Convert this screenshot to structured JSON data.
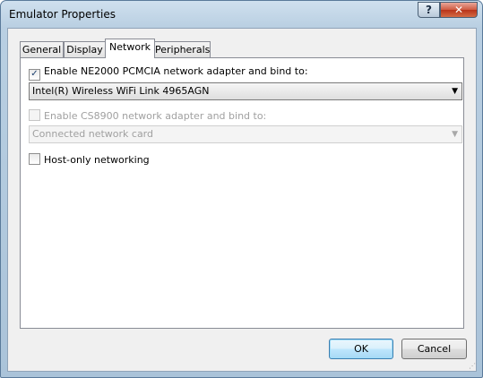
{
  "window": {
    "title": "Emulator Properties",
    "help_label": "?",
    "close_label": "✕"
  },
  "tabs": [
    {
      "label": "General",
      "active": false
    },
    {
      "label": "Display",
      "active": false
    },
    {
      "label": "Network",
      "active": true
    },
    {
      "label": "Peripherals",
      "active": false
    }
  ],
  "network": {
    "ne2000": {
      "checked": true,
      "label": "Enable NE2000 PCMCIA network adapter and bind to:",
      "selected": "Intel(R) Wireless WiFi Link 4965AGN"
    },
    "cs8900": {
      "checked": false,
      "enabled": false,
      "label": "Enable CS8900 network adapter and bind to:",
      "selected": "Connected network card"
    },
    "host_only": {
      "checked": false,
      "label": "Host-only networking"
    }
  },
  "buttons": {
    "ok": "OK",
    "cancel": "Cancel"
  },
  "icons": {
    "check": "✓",
    "dropdown": "▼"
  }
}
